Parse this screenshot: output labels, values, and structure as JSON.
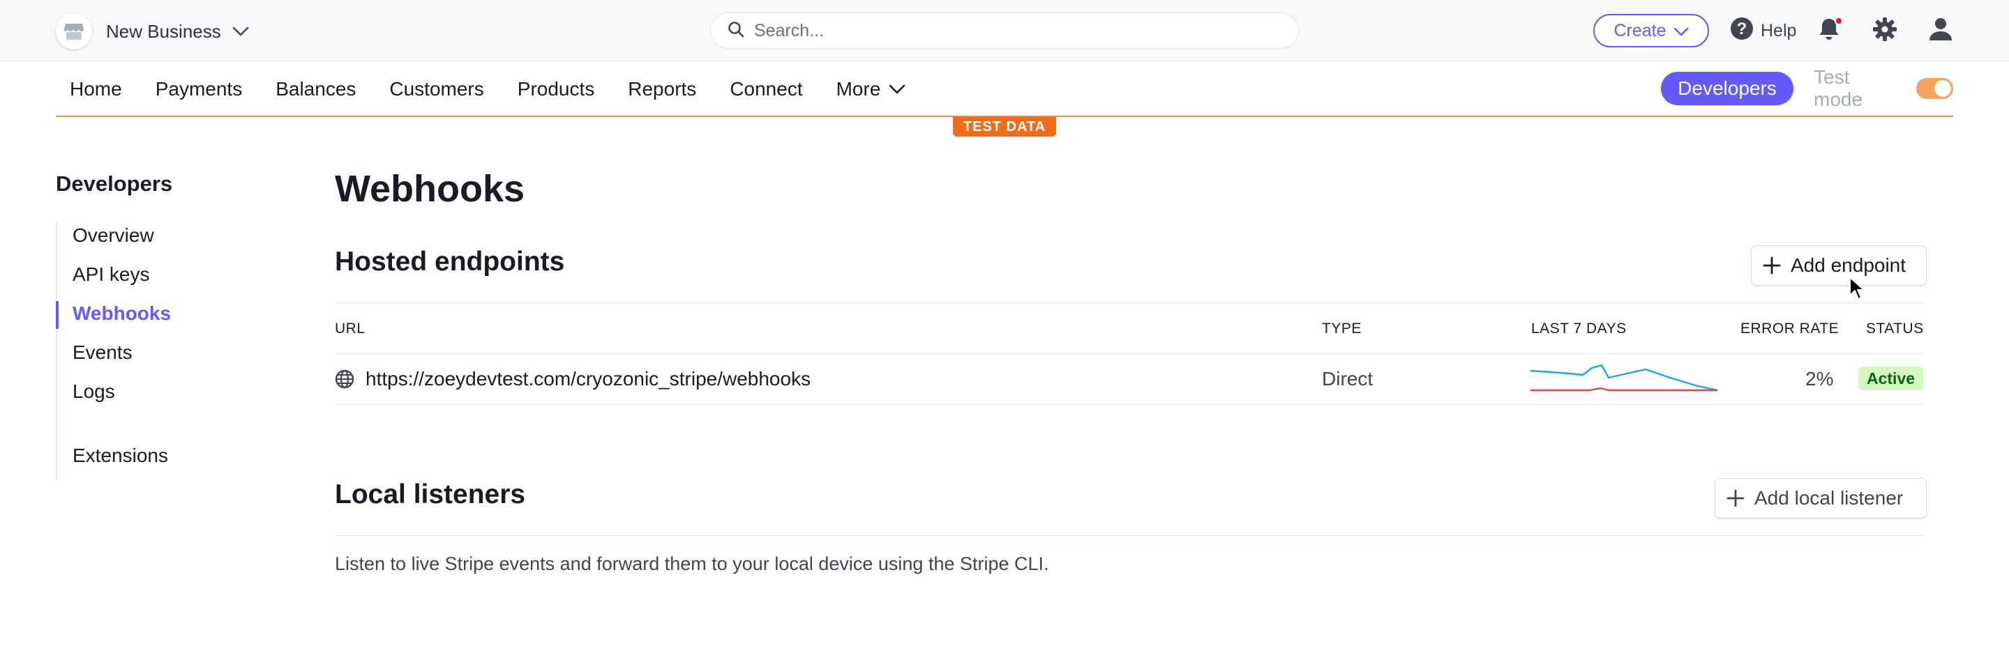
{
  "topbar": {
    "business_name": "New Business",
    "search_placeholder": "Search...",
    "create_label": "Create",
    "help_label": "Help"
  },
  "nav": {
    "items": [
      {
        "label": "Home"
      },
      {
        "label": "Payments"
      },
      {
        "label": "Balances"
      },
      {
        "label": "Customers"
      },
      {
        "label": "Products"
      },
      {
        "label": "Reports"
      },
      {
        "label": "Connect"
      },
      {
        "label": "More"
      }
    ],
    "developers_label": "Developers",
    "test_mode_label": "Test mode",
    "test_mode_on": true,
    "test_data_badge": "TEST DATA"
  },
  "sidebar": {
    "title": "Developers",
    "items": [
      {
        "label": "Overview"
      },
      {
        "label": "API keys"
      },
      {
        "label": "Webhooks",
        "active": true
      },
      {
        "label": "Events"
      },
      {
        "label": "Logs"
      },
      {
        "label": "Extensions"
      }
    ]
  },
  "main": {
    "title": "Webhooks",
    "hosted": {
      "title": "Hosted endpoints",
      "add_label": "Add endpoint",
      "columns": [
        "URL",
        "TYPE",
        "LAST 7 DAYS",
        "ERROR RATE",
        "STATUS"
      ],
      "rows": [
        {
          "url": "https://zoeydevtest.com/cryozonic_stripe/webhooks",
          "type": "Direct",
          "error_rate": "2%",
          "status": "Active"
        }
      ]
    },
    "local": {
      "title": "Local listeners",
      "add_label": "Add local listener",
      "description": "Listen to live Stripe events and forward them to your local device using the Stripe CLI."
    }
  },
  "colors": {
    "accent": "#635bff",
    "test_orange": "#ef6d1a",
    "sparkline_success": "#1ba9d8",
    "sparkline_error": "#e5424d",
    "status_active_bg": "#d7f7c2"
  }
}
